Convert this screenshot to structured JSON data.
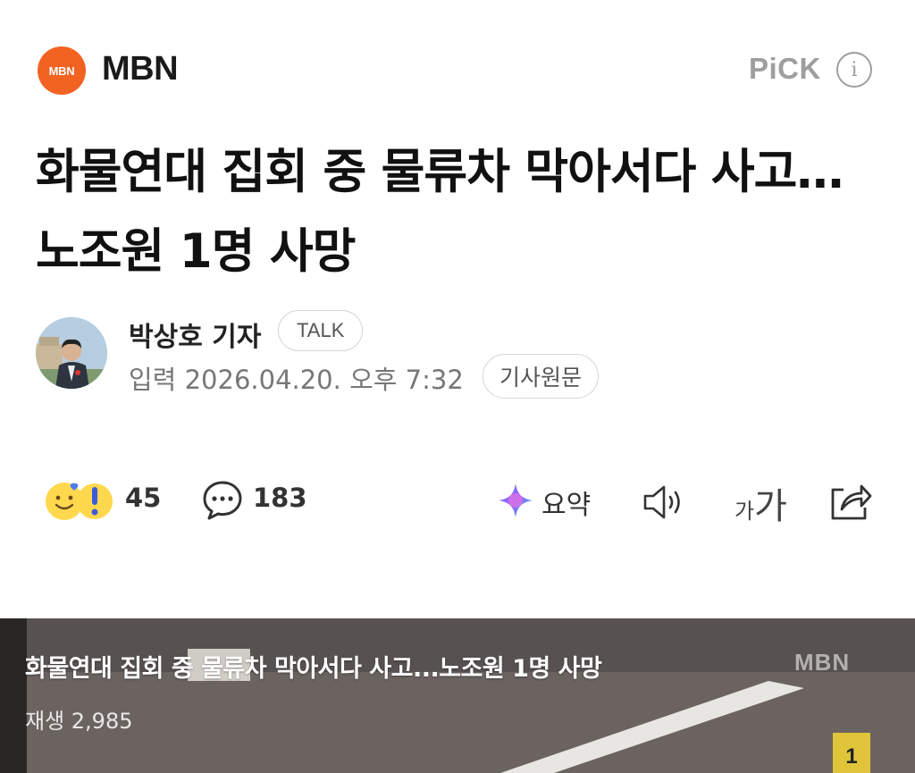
{
  "press": {
    "logo_text": "MBN",
    "name": "MBN",
    "pick_label": "PiCK",
    "logo_color": "#f26322"
  },
  "article": {
    "headline": "화물연대 집회 중 물류차 막아서다 사고…노조원 1명 사망",
    "reporter": "박상호 기자",
    "talk_label": "TALK",
    "date_label": "입력",
    "date_value": "2026.04.20. 오후 7:32",
    "original_label": "기사원문"
  },
  "actions": {
    "reaction_count": "45",
    "comment_count": "183",
    "summary_label": "요약",
    "font_small": "가",
    "font_large": "가"
  },
  "video": {
    "title": "화물연대 집회 중 물류차 막아서다 사고...노조원 1명 사망",
    "watermark": "MBN",
    "play_count": "재생 2,985",
    "marker": "1"
  }
}
